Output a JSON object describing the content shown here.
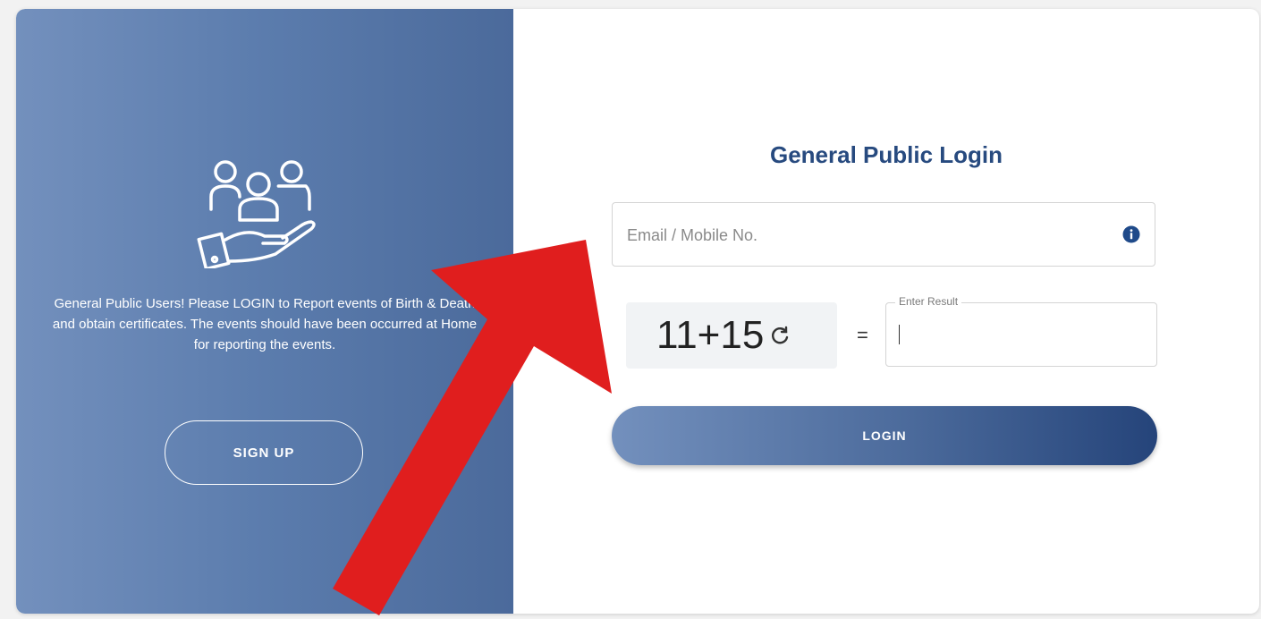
{
  "left_panel": {
    "message": "General Public Users! Please LOGIN to Report events of Birth & Death and obtain certificates. The events should have been occurred at Home for reporting the events.",
    "signup_label": "SIGN UP",
    "icon": "people-on-hand-icon"
  },
  "form": {
    "title": "General Public Login",
    "email_placeholder": "Email / Mobile No.",
    "info_icon": "info-icon",
    "captcha": {
      "expression": "11+15",
      "refresh_icon": "refresh-icon",
      "equals": "=",
      "result_label": "Enter Result",
      "result_value": ""
    },
    "login_label": "LOGIN"
  },
  "annotation": {
    "arrow_color": "#e01e1e"
  },
  "colors": {
    "title": "#274a7f",
    "panel_light": "#7390bd",
    "panel_dark": "#4b6a9b",
    "button_dark": "#25447a"
  }
}
